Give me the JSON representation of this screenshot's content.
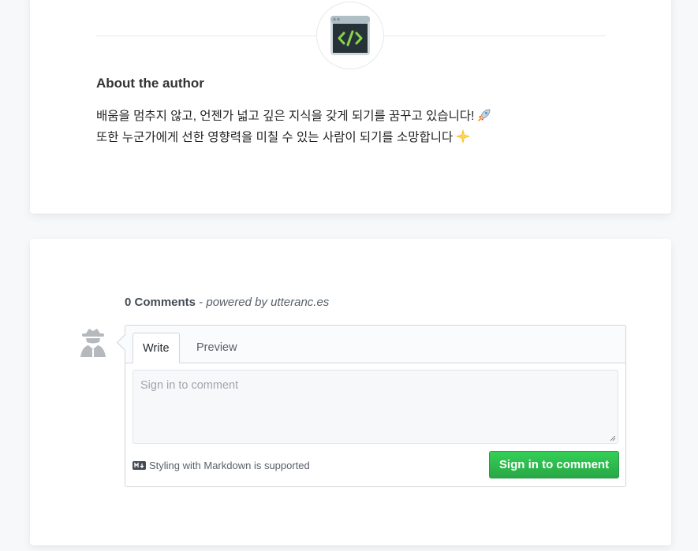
{
  "author": {
    "heading": "About the author",
    "bio_line1": "배움을 멈추지 않고, 언젠가 넓고 깊은 지식을 갖게 되기를 꿈꾸고 있습니다!",
    "bio_line2": "또한 누군가에게 선한 영향력을 미칠 수 있는 사람이 되기를 소망합니다",
    "emoji1": "rocket-icon",
    "emoji2": "sparkle-icon",
    "avatar_icon": "code-window-icon"
  },
  "comments": {
    "count_label": "0 Comments",
    "separator": " - ",
    "powered_by": "powered by utteranc.es",
    "tabs": [
      {
        "label": "Write"
      },
      {
        "label": "Preview"
      }
    ],
    "placeholder": "Sign in to comment",
    "markdown_note": "Styling with Markdown is supported",
    "button_label": "Sign in to comment",
    "button_color": "#2ea44f"
  }
}
